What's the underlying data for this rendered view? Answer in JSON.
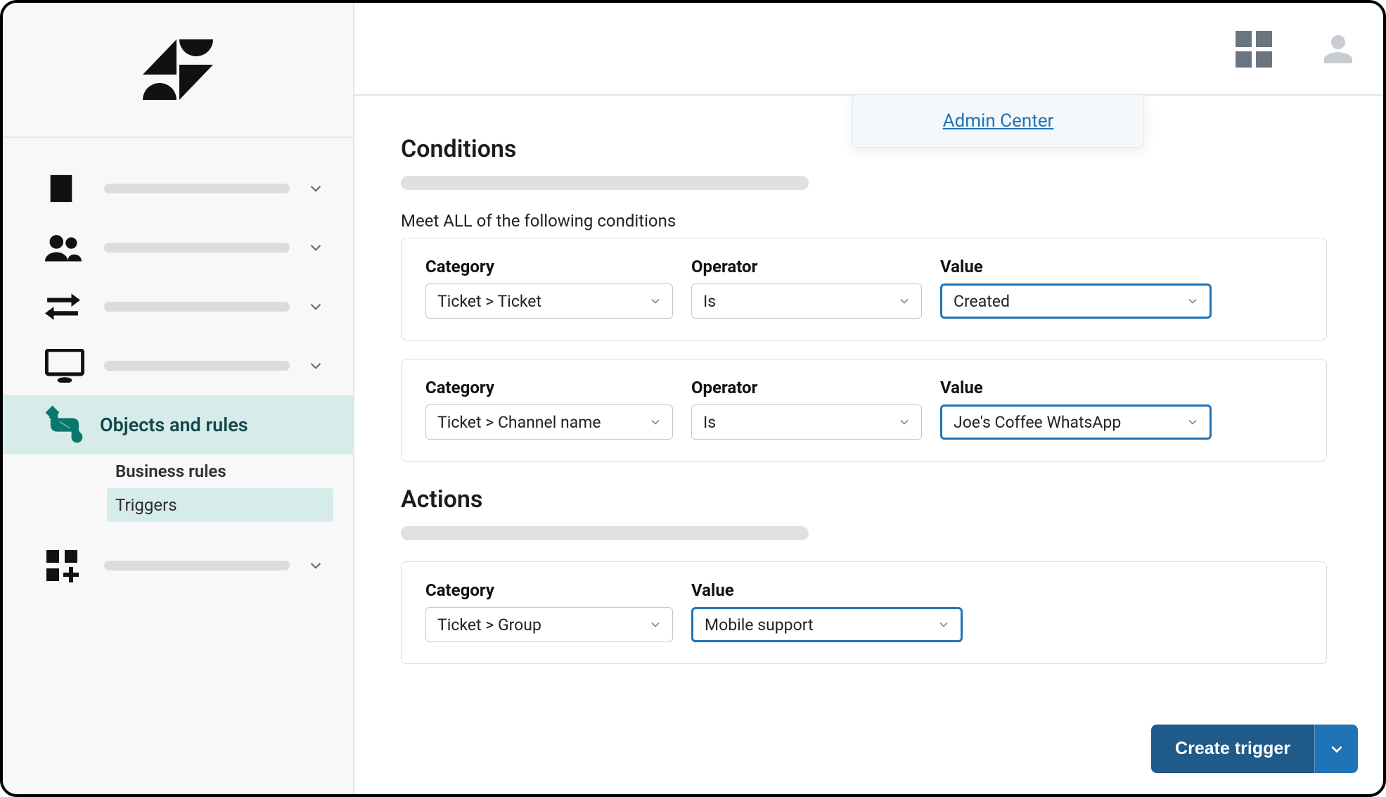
{
  "header": {
    "admin_center_label": "Admin Center"
  },
  "sidebar": {
    "active_item_label": "Objects and rules",
    "sub_items": {
      "business_rules": "Business rules",
      "triggers": "Triggers"
    }
  },
  "conditions": {
    "title": "Conditions",
    "meet_all_label": "Meet ALL of the following conditions",
    "labels": {
      "category": "Category",
      "operator": "Operator",
      "value": "Value"
    },
    "rows": [
      {
        "category": "Ticket > Ticket",
        "operator": "Is",
        "value": "Created"
      },
      {
        "category": "Ticket > Channel name",
        "operator": "Is",
        "value": "Joe's Coffee WhatsApp"
      }
    ]
  },
  "actions": {
    "title": "Actions",
    "labels": {
      "category": "Category",
      "value": "Value"
    },
    "rows": [
      {
        "category": "Ticket > Group",
        "value": "Mobile support"
      }
    ]
  },
  "footer": {
    "create_trigger_label": "Create trigger"
  }
}
